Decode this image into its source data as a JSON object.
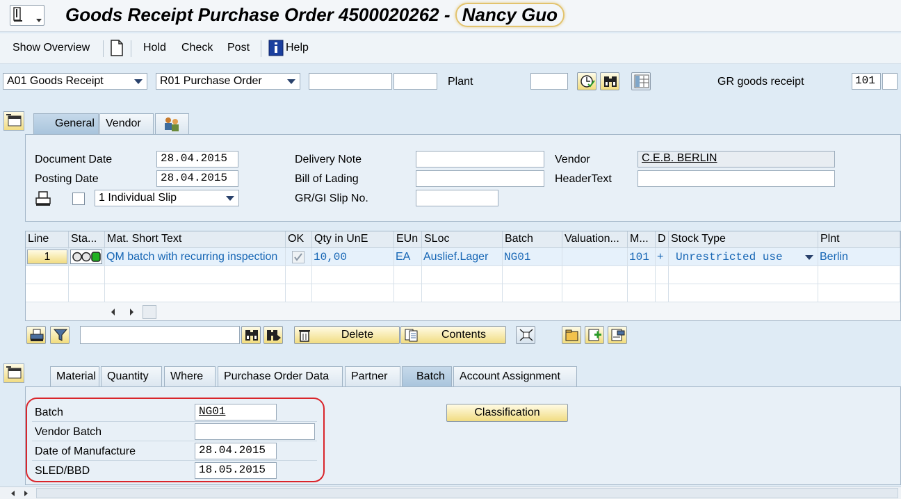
{
  "title": {
    "prefix": "Goods Receipt Purchase Order 4500020262 -",
    "user": "Nancy Guo"
  },
  "toolbar": {
    "show_overview": "Show Overview",
    "hold": "Hold",
    "check": "Check",
    "post": "Post",
    "help": "Help"
  },
  "header": {
    "action": "A01 Goods Receipt",
    "reference": "R01 Purchase Order",
    "po_number": "",
    "po_item": "",
    "plant_label": "Plant",
    "plant_value": "",
    "gr_label": "GR goods receipt",
    "movement_type": "101",
    "movement_ind": ""
  },
  "header_tabs": [
    "General",
    "Vendor"
  ],
  "general": {
    "document_date_label": "Document Date",
    "document_date": "28.04.2015",
    "posting_date_label": "Posting Date",
    "posting_date": "28.04.2015",
    "slip_option": "1 Individual Slip",
    "delivery_note_label": "Delivery Note",
    "delivery_note": "",
    "bill_of_lading_label": "Bill of Lading",
    "bill_of_lading": "",
    "gr_slip_label": "GR/GI Slip No.",
    "gr_slip": "",
    "vendor_label": "Vendor",
    "vendor": "C.E.B. BERLIN",
    "header_text_label": "HeaderText",
    "header_text": ""
  },
  "table": {
    "columns": [
      "Line",
      "Sta...",
      "Mat. Short Text",
      "OK",
      "Qty in UnE",
      "EUn",
      "SLoc",
      "Batch",
      "Valuation...",
      "M...",
      "D",
      "Stock Type",
      "Plnt"
    ],
    "rows": [
      {
        "line": "1",
        "text": "QM batch with recurring inspection",
        "qty": "10,00",
        "eun": "EA",
        "sloc": "Auslief.Lager",
        "batch": "NG01",
        "valuation": "",
        "mvt": "101",
        "debit": "+",
        "stock_type": "Unrestricted use",
        "plant": "Berlin"
      }
    ]
  },
  "item_toolbar": {
    "delete": "Delete",
    "contents": "Contents",
    "search_value": ""
  },
  "detail_tabs": [
    "Material",
    "Quantity",
    "Where",
    "Purchase Order Data",
    "Partner",
    "Batch",
    "Account Assignment"
  ],
  "batch": {
    "batch_label": "Batch",
    "batch_value": "NG01",
    "vendor_batch_label": "Vendor Batch",
    "vendor_batch": "",
    "manufacture_label": "Date of Manufacture",
    "manufacture_date": "28.04.2015",
    "sled_label": "SLED/BBD",
    "sled_date": "18.05.2015",
    "classification": "Classification"
  },
  "colors": {
    "accent_blue": "#1565b4",
    "highlight_red": "#d9252b",
    "button_yellow": "#f1dc82"
  }
}
